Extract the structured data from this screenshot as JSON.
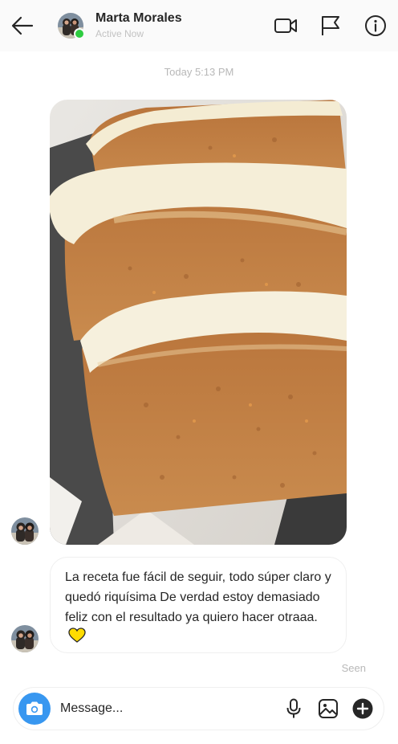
{
  "header": {
    "contact_name": "Marta Morales",
    "status": "Active Now",
    "icons": [
      "back-arrow-icon",
      "video-camera-icon",
      "flag-icon",
      "info-icon"
    ]
  },
  "conversation": {
    "timestamp": "Today 5:13 PM",
    "photo_alt": "carrot cake slices",
    "message_text": "La receta fue fácil de seguir, todo súper claro y quedó riquísima De verdad estoy demasiado feliz con el resultado ya quiero hacer otraaa.",
    "message_emoji": "yellow-heart",
    "seen_label": "Seen"
  },
  "composer": {
    "placeholder": "Message...",
    "icons": [
      "camera-icon",
      "microphone-icon",
      "image-icon",
      "plus-icon"
    ]
  },
  "colors": {
    "accent": "#3897f0",
    "active": "#2ecc40",
    "heart": "#ffdc00",
    "muted_text": "#b8b8b8"
  }
}
